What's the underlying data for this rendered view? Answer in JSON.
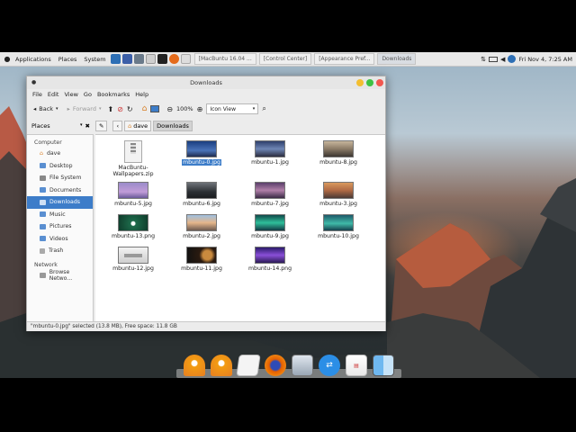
{
  "panel": {
    "menus": [
      "Applications",
      "Places",
      "System"
    ],
    "tasks": [
      {
        "label": "[MacBuntu 16.04 ..."
      },
      {
        "label": "[Control Center]"
      },
      {
        "label": "[Appearance Pref..."
      },
      {
        "label": "Downloads"
      }
    ],
    "clock": "Fri Nov  4,  7:25 AM"
  },
  "window": {
    "title": "Downloads",
    "menu": [
      "File",
      "Edit",
      "View",
      "Go",
      "Bookmarks",
      "Help"
    ],
    "toolbar": {
      "back": "Back",
      "forward": "Forward",
      "zoom": "100%",
      "view_mode": "Icon View"
    },
    "path": {
      "places_label": "Places",
      "crumbs": [
        "dave",
        "Downloads"
      ]
    },
    "sidebar": {
      "computer_heading": "Computer",
      "computer_items": [
        "dave",
        "Desktop",
        "File System",
        "Documents",
        "Downloads",
        "Music",
        "Pictures",
        "Videos",
        "Trash"
      ],
      "network_heading": "Network",
      "network_items": [
        "Browse Netwo..."
      ]
    },
    "files": [
      {
        "name": "MacBuntu-Wallpapers.zip"
      },
      {
        "name": "mbuntu-0.jpg"
      },
      {
        "name": "mbuntu-1.jpg"
      },
      {
        "name": "mbuntu-8.jpg"
      },
      {
        "name": "mbuntu-5.jpg"
      },
      {
        "name": "mbuntu-6.jpg"
      },
      {
        "name": "mbuntu-7.jpg"
      },
      {
        "name": "mbuntu-3.jpg"
      },
      {
        "name": "mbuntu-13.png"
      },
      {
        "name": "mbuntu-2.jpg"
      },
      {
        "name": "mbuntu-9.jpg"
      },
      {
        "name": "mbuntu-10.jpg"
      },
      {
        "name": "mbuntu-12.jpg"
      },
      {
        "name": "mbuntu-11.jpg"
      },
      {
        "name": "mbuntu-14.png"
      }
    ],
    "status": "\"mbuntu-0.jpg\" selected (13.8 MB), Free space: 11.8 GB"
  },
  "colors": {
    "selection": "#3d7dc9",
    "close": "#f2574f",
    "minimize": "#f3be30",
    "maximize": "#3dc142"
  }
}
